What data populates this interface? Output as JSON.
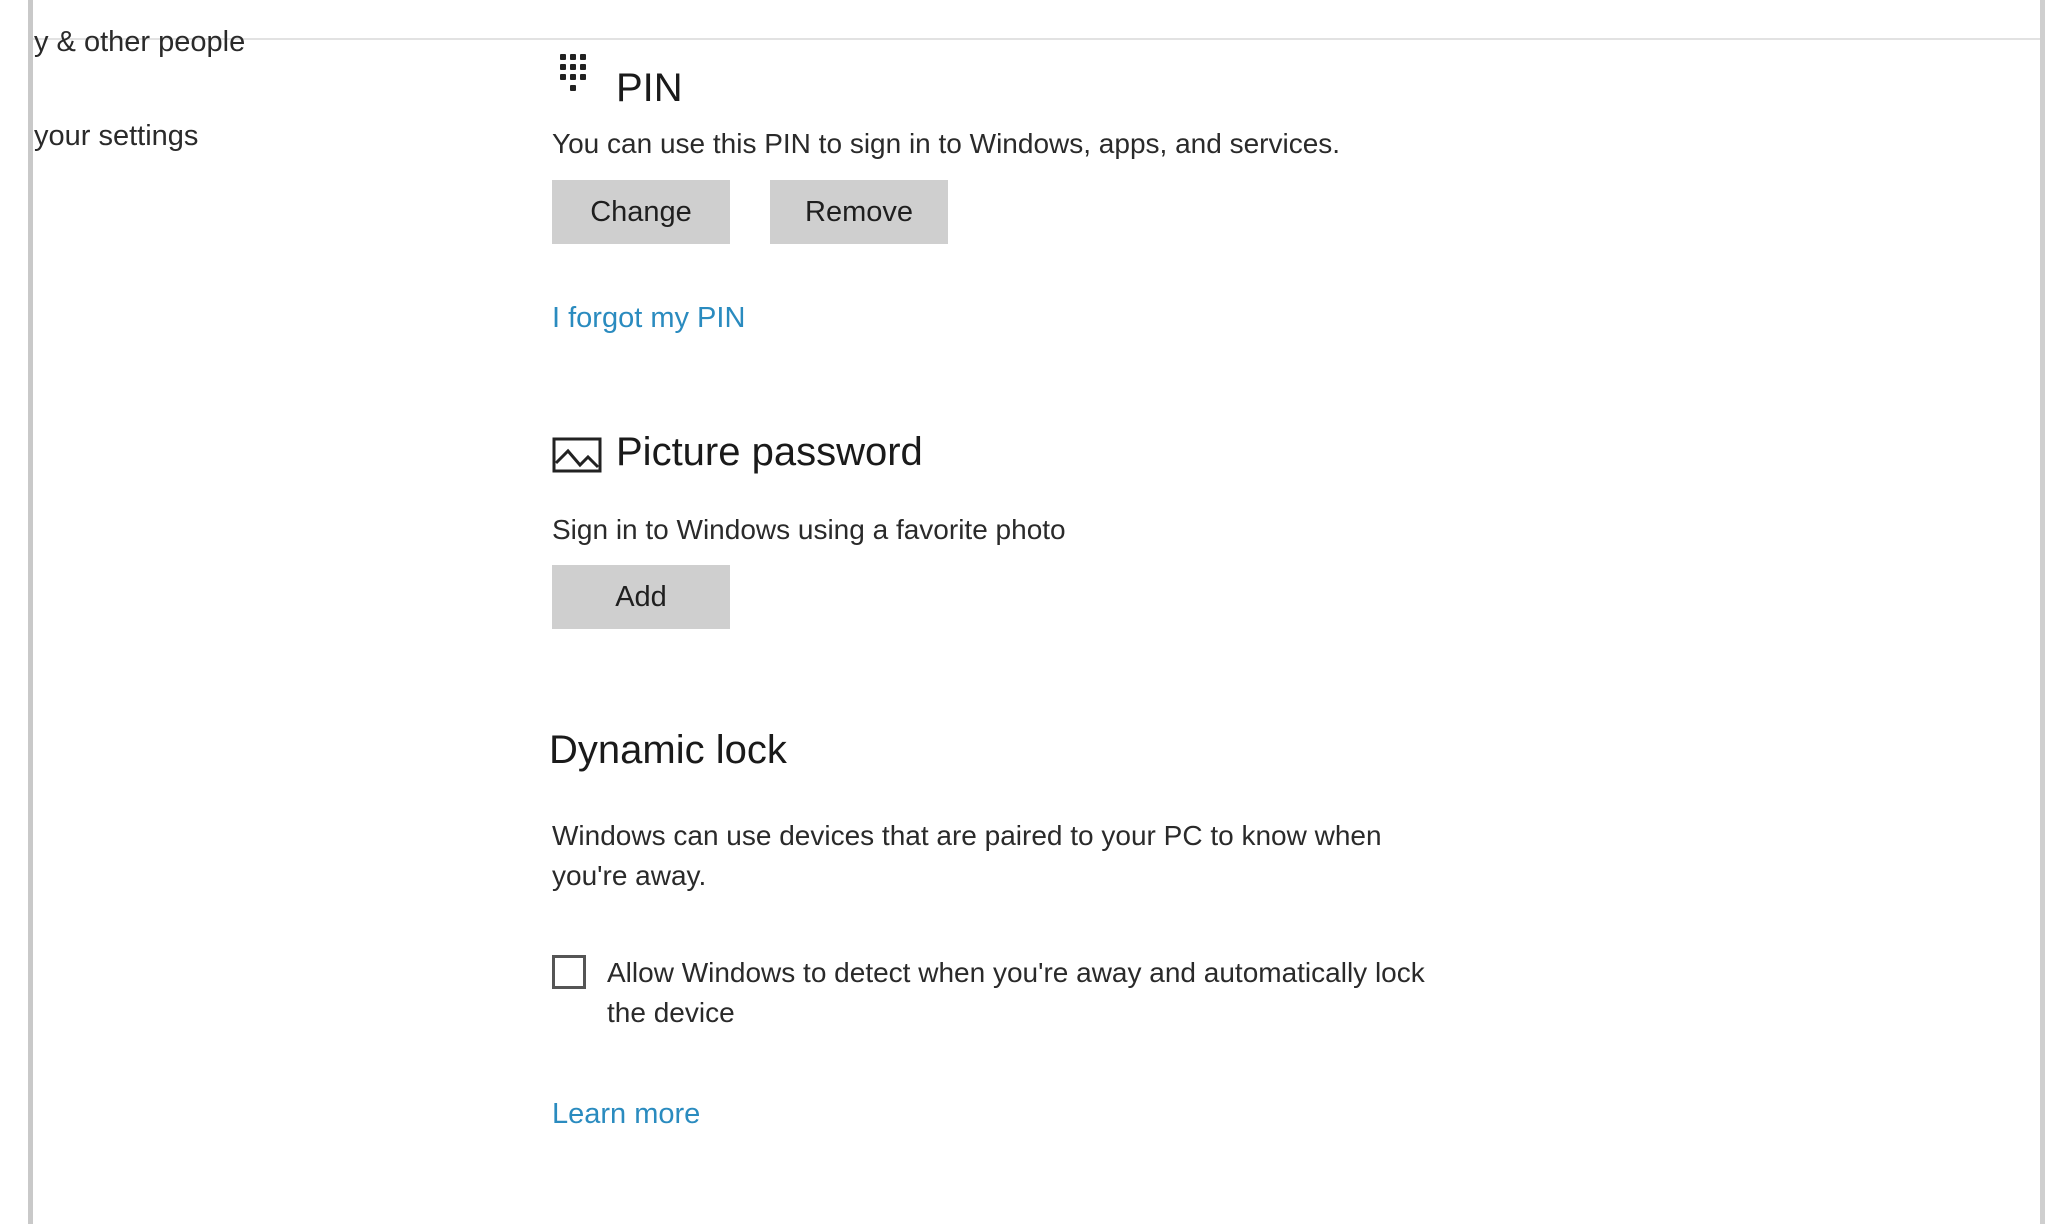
{
  "sidebar": {
    "items": [
      {
        "label": "y & other people"
      },
      {
        "label": "your settings"
      }
    ]
  },
  "pin": {
    "heading": "PIN",
    "icon": "keypad-icon",
    "description": "You can use this PIN to sign in to Windows, apps, and services.",
    "change_label": "Change",
    "remove_label": "Remove",
    "forgot_link": "I forgot my PIN"
  },
  "picture_password": {
    "heading": "Picture password",
    "icon": "picture-icon",
    "description": "Sign in to Windows using a favorite photo",
    "add_label": "Add"
  },
  "dynamic_lock": {
    "heading": "Dynamic lock",
    "description": "Windows can use devices that are paired to your PC to know when you're away.",
    "checkbox_label": "Allow Windows to detect when you're away and automatically lock the device",
    "checkbox_checked": false,
    "learn_more_link": "Learn more"
  },
  "colors": {
    "link": "#2a8bbf",
    "button_bg": "#cfcfcf"
  }
}
